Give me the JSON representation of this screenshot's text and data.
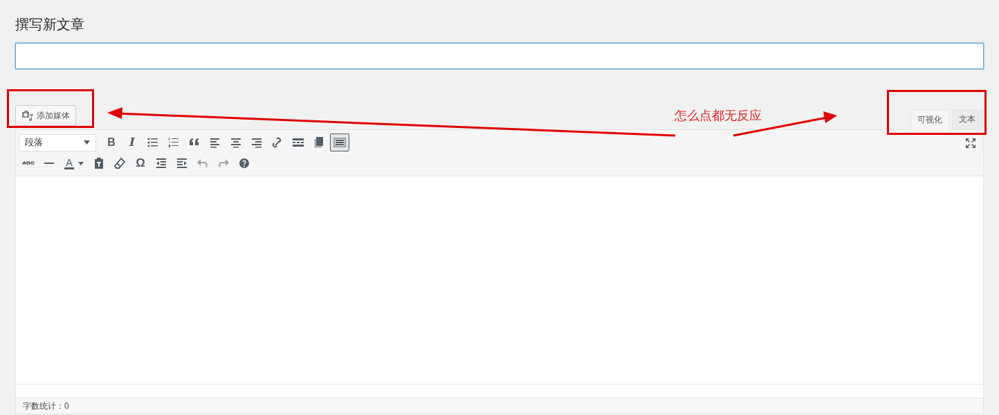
{
  "heading": "撰写新文章",
  "add_media_button": "添加媒体",
  "editor_tabs": [
    {
      "label": "可视化",
      "selected": true
    },
    {
      "label": "文本",
      "selected": false
    }
  ],
  "format_select": {
    "value": "段落"
  },
  "toolbar_row_1": [
    {
      "kind": "bold",
      "label": "B"
    },
    {
      "kind": "italic",
      "label": "I"
    },
    {
      "kind": "bullets"
    },
    {
      "kind": "numbers"
    },
    {
      "kind": "quote"
    },
    {
      "kind": "align-left"
    },
    {
      "kind": "align-center"
    },
    {
      "kind": "align-right"
    },
    {
      "kind": "link"
    },
    {
      "kind": "more"
    },
    {
      "kind": "pages"
    },
    {
      "kind": "toolbar-toggle",
      "pressed": true
    }
  ],
  "toolbar_row_2": [
    {
      "kind": "strike",
      "label": "ABC"
    },
    {
      "kind": "hr"
    },
    {
      "kind": "color",
      "label": "A"
    },
    {
      "kind": "paste"
    },
    {
      "kind": "eraser"
    },
    {
      "kind": "symbol",
      "label": "Ω"
    },
    {
      "kind": "outdent"
    },
    {
      "kind": "indent"
    },
    {
      "kind": "undo",
      "disabled": true
    },
    {
      "kind": "redo",
      "disabled": true
    },
    {
      "kind": "help"
    }
  ],
  "status_bar": "字数统计：0",
  "annotation": {
    "text": "怎么点都无反应"
  }
}
